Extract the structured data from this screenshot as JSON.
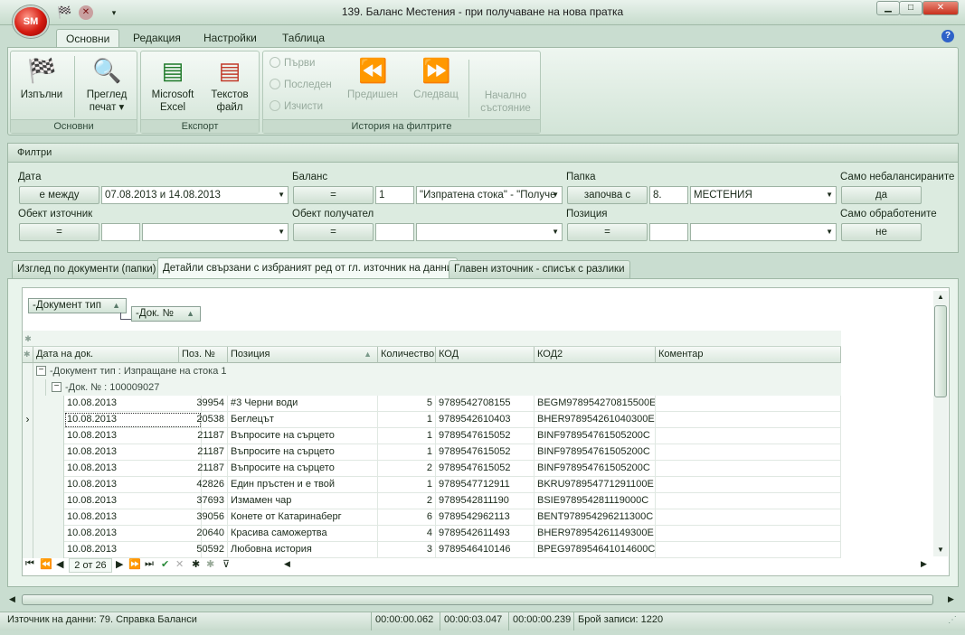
{
  "window": {
    "title": "139. Баланс Местения - при получаване на нова пратка",
    "logo": "SM",
    "controls": {
      "minimize": "▁",
      "maximize": "□",
      "close": "✕"
    }
  },
  "ribbon_tabs": [
    "Основни",
    "Редакция",
    "Настройки",
    "Таблица"
  ],
  "ribbon": {
    "groups": [
      {
        "label": "Основни"
      },
      {
        "label": "Експорт"
      },
      {
        "label": "История на филтрите"
      }
    ],
    "run": {
      "line1": "Изпълни",
      "line2": ""
    },
    "preview": {
      "line1": "Преглед",
      "line2": "печат ▾"
    },
    "excel": {
      "line1": "Microsoft",
      "line2": "Excel"
    },
    "text": {
      "line1": "Текстов",
      "line2": "файл"
    },
    "history_small": [
      "Първи",
      "Последен",
      "Изчисти"
    ],
    "prev": {
      "line1": "Предишен"
    },
    "next": {
      "line1": "Следващ"
    },
    "initial": {
      "line1": "Начално",
      "line2": "състояние"
    }
  },
  "filters": {
    "title": "Филтри",
    "date": {
      "label": "Дата",
      "op": "е между",
      "value": "07.08.2013 и 14.08.2013"
    },
    "balance": {
      "label": "Баланс",
      "op": "=",
      "value1": "1",
      "value2": "\"Изпратена стока\" - \"Получе"
    },
    "folder": {
      "label": "Папка",
      "op": "започва с",
      "value1": "8.",
      "value2": "МЕСТЕНИЯ"
    },
    "unbalanced": {
      "label": "Само небалансираните",
      "value": "да"
    },
    "source": {
      "label": "Обект източник",
      "op": "=",
      "value1": "",
      "value2": ""
    },
    "receiver": {
      "label": "Обект получател",
      "op": "=",
      "value1": "",
      "value2": ""
    },
    "position": {
      "label": "Позиция",
      "op": "=",
      "value1": "",
      "value2": ""
    },
    "processed": {
      "label": "Само обработените",
      "value": "не"
    }
  },
  "page_tabs": [
    "Изглед по документи (папки)",
    "Детайли свързани с избраният ред от гл. източник на данни",
    "Главен източник - списък с разлики"
  ],
  "grid": {
    "group_chips": [
      "-Документ тип",
      "-Док. №"
    ],
    "columns": [
      "Дата на док.",
      "Поз. №",
      "Позиция",
      "Количество",
      "КОД",
      "КОД2",
      "Коментар"
    ],
    "group1": "-Документ тип : Изпращане на стока 1",
    "group2": "-Док. № : 100009027",
    "rows": [
      [
        "10.08.2013",
        "39954",
        "#3 Черни води",
        "5",
        "9789542708155",
        "BEGM978954270815500E",
        ""
      ],
      [
        "10.08.2013",
        "20538",
        "Беглецът",
        "1",
        "9789542610403",
        "BHER978954261040300E",
        ""
      ],
      [
        "10.08.2013",
        "21187",
        "Въпросите на сърцето",
        "1",
        "9789547615052",
        "BINF978954761505200C",
        ""
      ],
      [
        "10.08.2013",
        "21187",
        "Въпросите на сърцето",
        "1",
        "9789547615052",
        "BINF978954761505200C",
        ""
      ],
      [
        "10.08.2013",
        "21187",
        "Въпросите на сърцето",
        "2",
        "9789547615052",
        "BINF978954761505200C",
        ""
      ],
      [
        "10.08.2013",
        "42826",
        "Един пръстен и е твой",
        "1",
        "9789547712911",
        "BKRU978954771291100E",
        ""
      ],
      [
        "10.08.2013",
        "37693",
        "Измамен чар",
        "2",
        "9789542811190",
        "BSIE978954281119000C",
        ""
      ],
      [
        "10.08.2013",
        "39056",
        "Конете от Катаринаберг",
        "6",
        "9789542962113",
        "BENT978954296211300C",
        ""
      ],
      [
        "10.08.2013",
        "20640",
        "Красива саможертва",
        "4",
        "9789542611493",
        "BHER978954261149300E",
        ""
      ],
      [
        "10.08.2013",
        "50592",
        "Любовна история",
        "3",
        "9789546410146",
        "BPEG978954641014600C",
        ""
      ]
    ],
    "pager": "2 от 26"
  },
  "status": {
    "source": "Източник на данни: 79. Справка Баланси",
    "t1": "00:00:00.062",
    "t2": "00:00:03.047",
    "t3": "00:00:00.239",
    "count": "Брой записи: 1220"
  }
}
